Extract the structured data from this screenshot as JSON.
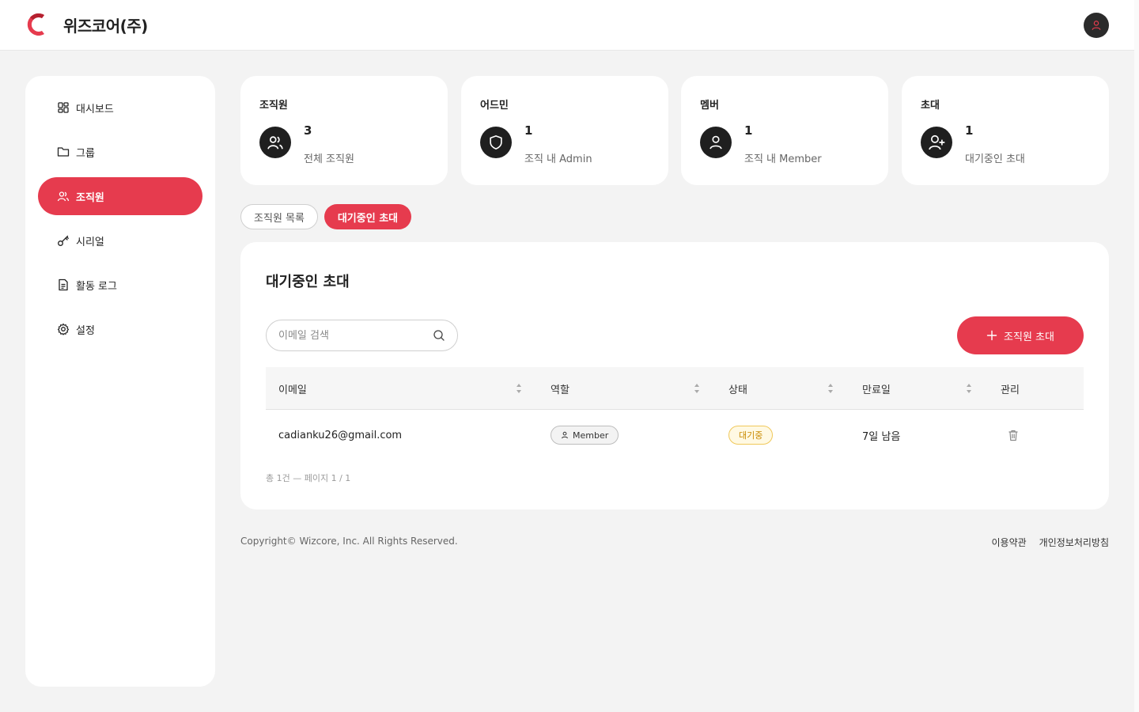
{
  "header": {
    "company_name": "위즈코어(주)"
  },
  "sidebar": {
    "items": [
      {
        "label": "대시보드",
        "icon": "dashboard-icon",
        "active": false
      },
      {
        "label": "그룹",
        "icon": "folder-icon",
        "active": false
      },
      {
        "label": "조직원",
        "icon": "users-icon",
        "active": true
      },
      {
        "label": "시리얼",
        "icon": "key-icon",
        "active": false
      },
      {
        "label": "활동 로그",
        "icon": "document-icon",
        "active": false
      },
      {
        "label": "설정",
        "icon": "gear-icon",
        "active": false
      }
    ]
  },
  "stats": [
    {
      "title": "조직원",
      "value": "3",
      "desc": "전체 조직원",
      "icon": "users-icon"
    },
    {
      "title": "어드민",
      "value": "1",
      "desc": "조직 내 Admin",
      "icon": "shield-icon"
    },
    {
      "title": "멤버",
      "value": "1",
      "desc": "조직 내 Member",
      "icon": "user-icon"
    },
    {
      "title": "초대",
      "value": "1",
      "desc": "대기중인 초대",
      "icon": "user-plus-icon"
    }
  ],
  "tabs": [
    {
      "label": "조직원 목록",
      "active": false
    },
    {
      "label": "대기중인 초대",
      "active": true
    }
  ],
  "panel": {
    "title": "대기중인 초대",
    "search_placeholder": "이메일 검색",
    "invite_button": "조직원 초대",
    "columns": [
      "이메일",
      "역할",
      "상태",
      "만료일",
      "관리"
    ],
    "rows": [
      {
        "email": "cadianku26@gmail.com",
        "role": "Member",
        "status": "대기중",
        "expires": "7일 남음"
      }
    ],
    "page_info": "총 1건 — 페이지 1 / 1"
  },
  "footer": {
    "copyright": "Copyright© Wizcore, Inc. All Rights Reserved.",
    "links": [
      "이용약관",
      "개인정보처리방침"
    ]
  },
  "colors": {
    "accent": "#e63b4e",
    "pending_status": "#c98a00"
  }
}
